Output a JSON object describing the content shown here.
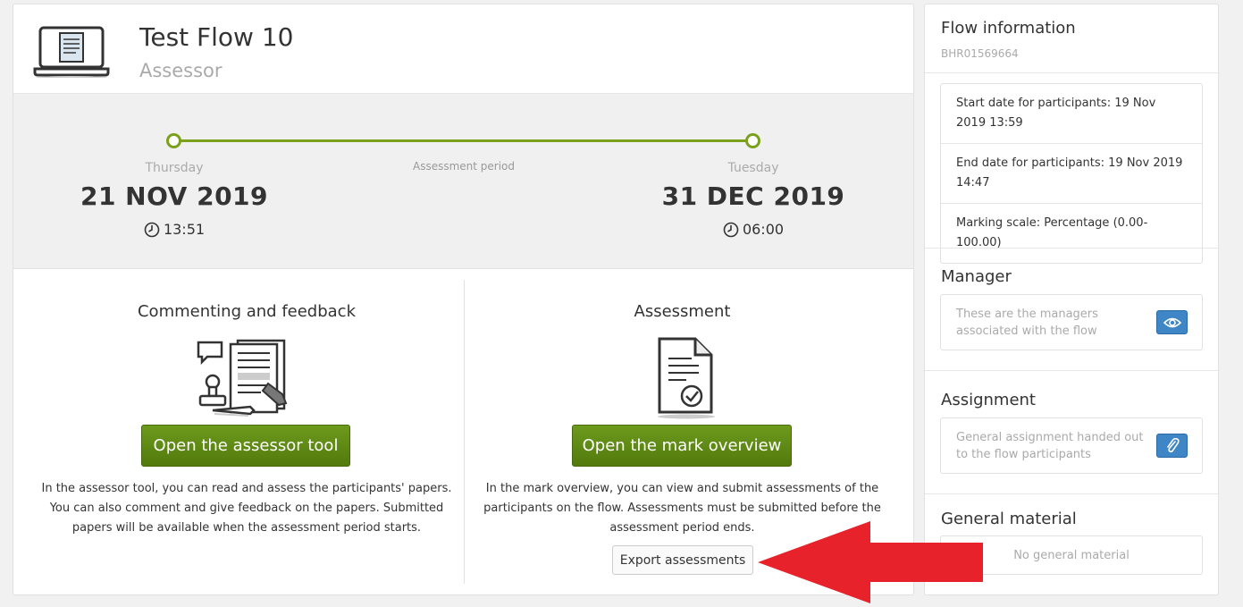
{
  "header": {
    "title": "Test Flow 10",
    "subtitle": "Assessor"
  },
  "timeline": {
    "start": {
      "day": "Thursday",
      "date": "21 NOV 2019",
      "time": "13:51"
    },
    "end": {
      "day": "Tuesday",
      "date": "31 DEC 2019",
      "time": "06:00"
    },
    "period_label": "Assessment period"
  },
  "commenting": {
    "heading": "Commenting and feedback",
    "button_label": "Open the assessor tool",
    "description": "In the assessor tool, you can read and assess the participants' papers. You can also comment and give feedback on the papers. Submitted papers will be available when the assessment period starts."
  },
  "assessment": {
    "heading": "Assessment",
    "button_label": "Open the mark overview",
    "description": "In the mark overview, you can view and submit assessments of the participants on the flow. Assessments must be submitted before the assessment period ends.",
    "export_label": "Export assessments"
  },
  "sidebar": {
    "title": "Flow information",
    "reference": "BHR01569664",
    "info": [
      "Start date for participants: 19 Nov 2019 13:59",
      "End date for participants: 19 Nov 2019 14:47",
      "Marking scale: Percentage (0.00-100.00)"
    ],
    "manager": {
      "heading": "Manager",
      "text": "These are the managers associated with the flow"
    },
    "assignment": {
      "heading": "Assignment",
      "text": "General assignment handed out to the flow participants"
    },
    "general_material": {
      "heading": "General material",
      "text": "No general material"
    }
  },
  "colors": {
    "accent_green": "#7ba01c",
    "button_green": "#5f8a15",
    "button_blue": "#3f86c6",
    "annotation_red": "#e8222b"
  },
  "icons": [
    "laptop-icon",
    "clock-icon",
    "feedback-illustration",
    "document-check-illustration",
    "eye-icon",
    "paperclip-icon",
    "red-arrow"
  ]
}
